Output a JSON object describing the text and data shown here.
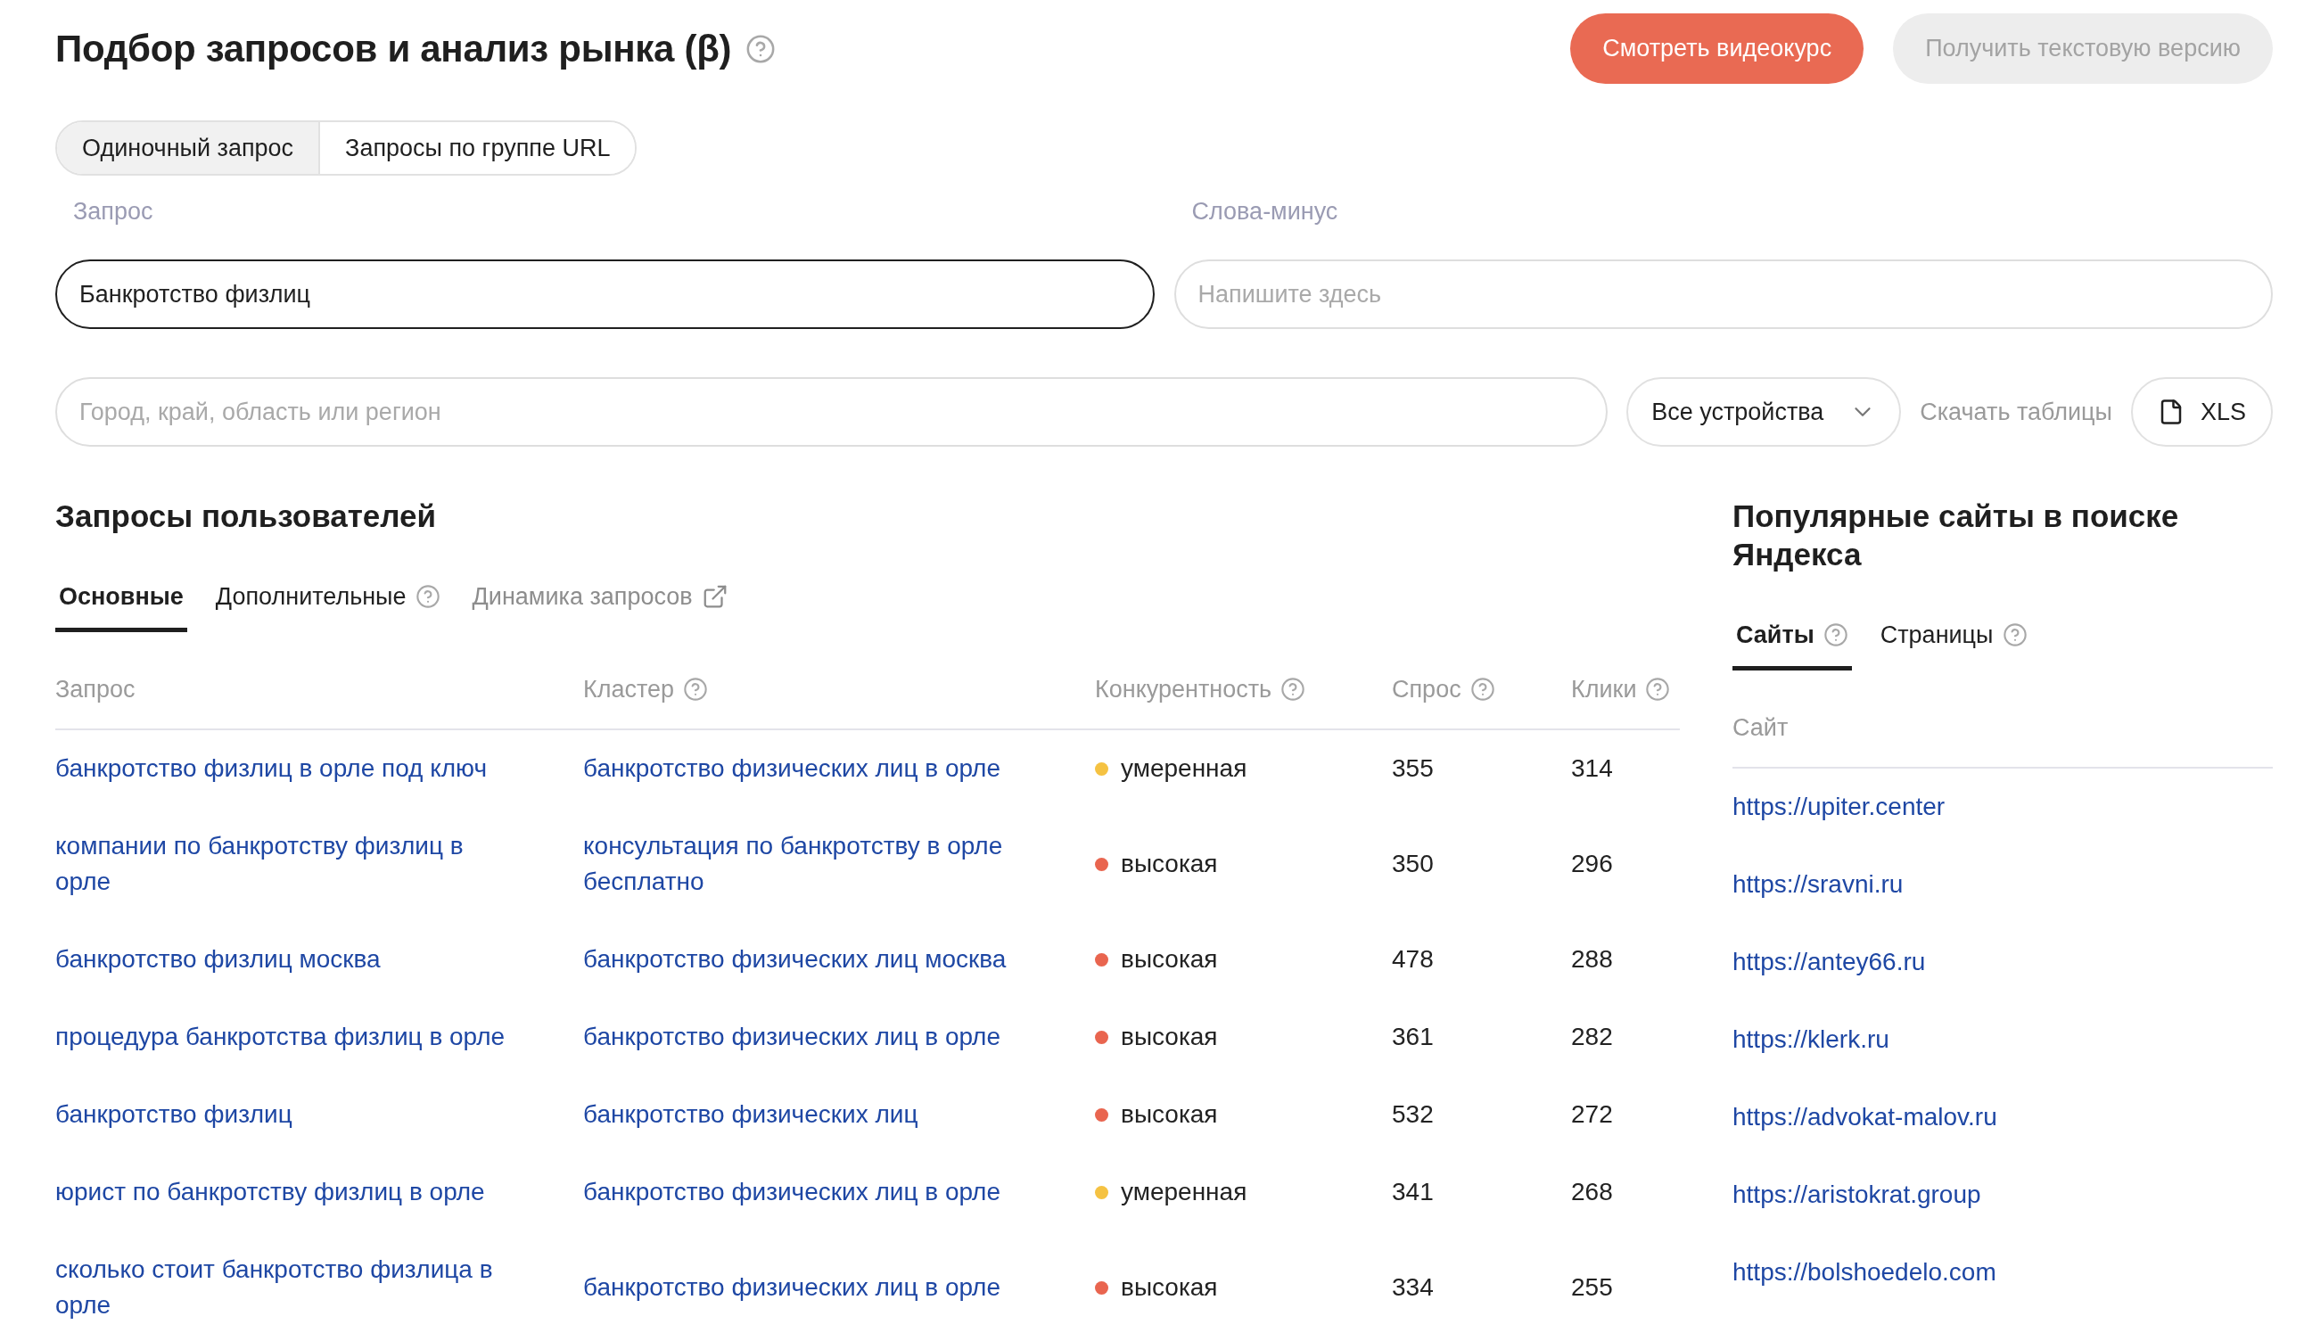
{
  "header": {
    "title": "Подбор запросов и анализ рынка (β)",
    "help": true,
    "buttons": [
      {
        "label": "Смотреть видеокурс",
        "kind": "primary"
      },
      {
        "label": "Получить текстовую версию",
        "kind": "secondary"
      }
    ]
  },
  "mode_switch": [
    {
      "label": "Одиночный запрос",
      "selected": true
    },
    {
      "label": "Запросы по группе URL",
      "selected": false
    }
  ],
  "fields": [
    {
      "label": "Запрос",
      "value": "Банкротство физлиц",
      "focused": true
    },
    {
      "label": "Слова-минус",
      "placeholder": "Напишите здесь",
      "focused": false
    }
  ],
  "filters": {
    "region": {
      "placeholder": "Город, край, область или регион"
    },
    "device": {
      "value": "Все устройства"
    },
    "download": {
      "label": "Скачать таблицы",
      "button": "XLS"
    }
  },
  "queries": {
    "title": "Запросы пользователей",
    "tabs": [
      {
        "label": "Основные",
        "kind": "tab",
        "help": false,
        "selected": true
      },
      {
        "label": "Дополнительные",
        "kind": "tab",
        "help": true,
        "selected": false
      },
      {
        "label": "Динамика запросов",
        "kind": "link",
        "help": false,
        "selected": false
      }
    ],
    "columns": [
      {
        "label": "Запрос",
        "help": false
      },
      {
        "label": "Кластер",
        "help": true
      },
      {
        "label": "Конкурентность",
        "help": true
      },
      {
        "label": "Спрос",
        "help": true
      },
      {
        "label": "Клики",
        "help": true
      }
    ],
    "rows": [
      {
        "query": "банкротство физлиц в орле под ключ",
        "cluster": "банкротство физических лиц в орле",
        "competition": "умеренная",
        "color": "#f5c242",
        "demand": "355",
        "clicks": "314"
      },
      {
        "query": "компании по банкротству физлиц в орле",
        "cluster": "консультация по банкротству в орле бесплатно",
        "competition": "высокая",
        "color": "#e9654f",
        "demand": "350",
        "clicks": "296"
      },
      {
        "query": "банкротство физлиц москва",
        "cluster": "банкротство физических лиц москва",
        "competition": "высокая",
        "color": "#e9654f",
        "demand": "478",
        "clicks": "288"
      },
      {
        "query": "процедура банкротства физлиц в орле",
        "cluster": "банкротство физических лиц в орле",
        "competition": "высокая",
        "color": "#e9654f",
        "demand": "361",
        "clicks": "282"
      },
      {
        "query": "банкротство физлиц",
        "cluster": "банкротство физических лиц",
        "competition": "высокая",
        "color": "#e9654f",
        "demand": "532",
        "clicks": "272"
      },
      {
        "query": "юрист по банкротству физлиц в орле",
        "cluster": "банкротство физических лиц в орле",
        "competition": "умеренная",
        "color": "#f5c242",
        "demand": "341",
        "clicks": "268"
      },
      {
        "query": "сколько стоит банкротство физлица в орле",
        "cluster": "банкротство физических лиц в орле",
        "competition": "высокая",
        "color": "#e9654f",
        "demand": "334",
        "clicks": "255"
      }
    ]
  },
  "sites": {
    "title": "Популярные сайты в поиске Яндекса",
    "tabs": [
      {
        "label": "Сайты",
        "help": true,
        "selected": true
      },
      {
        "label": "Страницы",
        "help": true,
        "selected": false
      }
    ],
    "column": "Сайт",
    "rows": [
      "https://upiter.center",
      "https://sravni.ru",
      "https://antey66.ru",
      "https://klerk.ru",
      "https://advokat-malov.ru",
      "https://aristokrat.group",
      "https://bolshoedelo.com"
    ]
  }
}
